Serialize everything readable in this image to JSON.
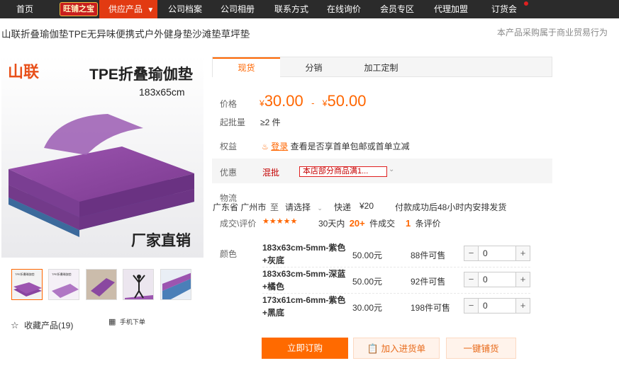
{
  "nav": {
    "home": "首页",
    "store_badge": "旺铺之宝",
    "supply": "供应产品",
    "archive": "公司档案",
    "album": "公司相册",
    "contact": "联系方式",
    "inquiry": "在线询价",
    "member": "会员专区",
    "agent": "代理加盟",
    "fair": "订货会"
  },
  "product": {
    "title": "山联折叠瑜伽垫TPE无异味便携式户外健身垫沙滩垫草坪垫",
    "trade_notice": "本产品采购属于商业贸易行为",
    "image_brand": "山联",
    "image_title": "TPE折叠瑜伽垫",
    "image_size": "183x65cm",
    "image_slogan": "厂家直销",
    "thumb_caption": "TPE折叠瑜伽垫"
  },
  "tabs": [
    "现货",
    "分销",
    "加工定制"
  ],
  "price": {
    "label": "价格",
    "currency": "¥",
    "low": "30.00",
    "dash": "-",
    "high": "50.00"
  },
  "moq": {
    "label": "起批量",
    "value": "≥2 件"
  },
  "rights": {
    "label": "权益",
    "login": "登录",
    "text": "查看是否享首单包邮或首单立减"
  },
  "promo": {
    "label": "优惠",
    "tag": "混批",
    "text": "本店部分商品满1..."
  },
  "logistics": {
    "label": "物流",
    "origin": "广东省 广州市",
    "to": "至",
    "dest": "请选择",
    "method": "快递",
    "fee": "¥20",
    "note": "付款成功后48小时内安排发货"
  },
  "reviews": {
    "label": "成交\\评价",
    "stars": "★★★★★",
    "sold_prefix": "30天内",
    "sold_count": "20+",
    "sold_suffix": "件成交",
    "review_count": "1",
    "review_suffix": "条评价"
  },
  "sku": {
    "label": "颜色",
    "items": [
      {
        "name": "183x63cm-5mm-紫色+灰底",
        "price": "50.00元",
        "stock": "88件可售",
        "qty": "0"
      },
      {
        "name": "183x63cm-5mm-深蓝+橘色",
        "price": "50.00元",
        "stock": "92件可售",
        "qty": "0"
      },
      {
        "name": "173x61cm-6mm-紫色+黑底",
        "price": "30.00元",
        "stock": "198件可售",
        "qty": "0"
      }
    ]
  },
  "actions": {
    "order": "立即订购",
    "cart": "加入进货单",
    "dropship": "一键铺货",
    "favorite": "收藏产品(19)",
    "mobile": "手机下单"
  },
  "colors": {
    "accent": "#ff6600",
    "nav_bg": "#2b2b2b",
    "supply_bg": "#e23a12",
    "mat_purple": "#8e4aa0",
    "mat_blue": "#4a7fb8"
  }
}
